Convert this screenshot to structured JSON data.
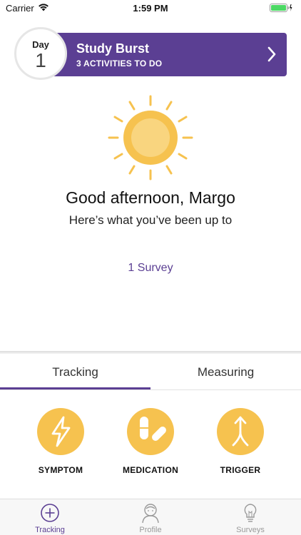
{
  "status_bar": {
    "carrier": "Carrier",
    "time": "1:59 PM"
  },
  "burst": {
    "day_label": "Day",
    "day_number": "1",
    "title": "Study Burst",
    "subtitle": "3 ACTIVITIES TO DO"
  },
  "greeting": {
    "title": "Good afternoon, Margo",
    "subtitle": "Here’s what you’ve been up to"
  },
  "summary": {
    "survey_link": "1 Survey"
  },
  "panel": {
    "tabs": [
      {
        "label": "Tracking",
        "selected": true
      },
      {
        "label": "Measuring",
        "selected": false
      }
    ],
    "actions": [
      {
        "label": "SYMPTOM",
        "icon": "lightning-icon"
      },
      {
        "label": "MEDICATION",
        "icon": "pills-icon"
      },
      {
        "label": "TRIGGER",
        "icon": "merge-arrow-icon"
      }
    ]
  },
  "tabbar": {
    "items": [
      {
        "label": "Tracking",
        "icon": "plus-circle-icon",
        "active": true
      },
      {
        "label": "Profile",
        "icon": "person-icon",
        "active": false
      },
      {
        "label": "Surveys",
        "icon": "lightbulb-icon",
        "active": false
      }
    ]
  },
  "colors": {
    "accent": "#5b3f93",
    "sun": "#f6c24f",
    "battery": "#4cd964"
  }
}
